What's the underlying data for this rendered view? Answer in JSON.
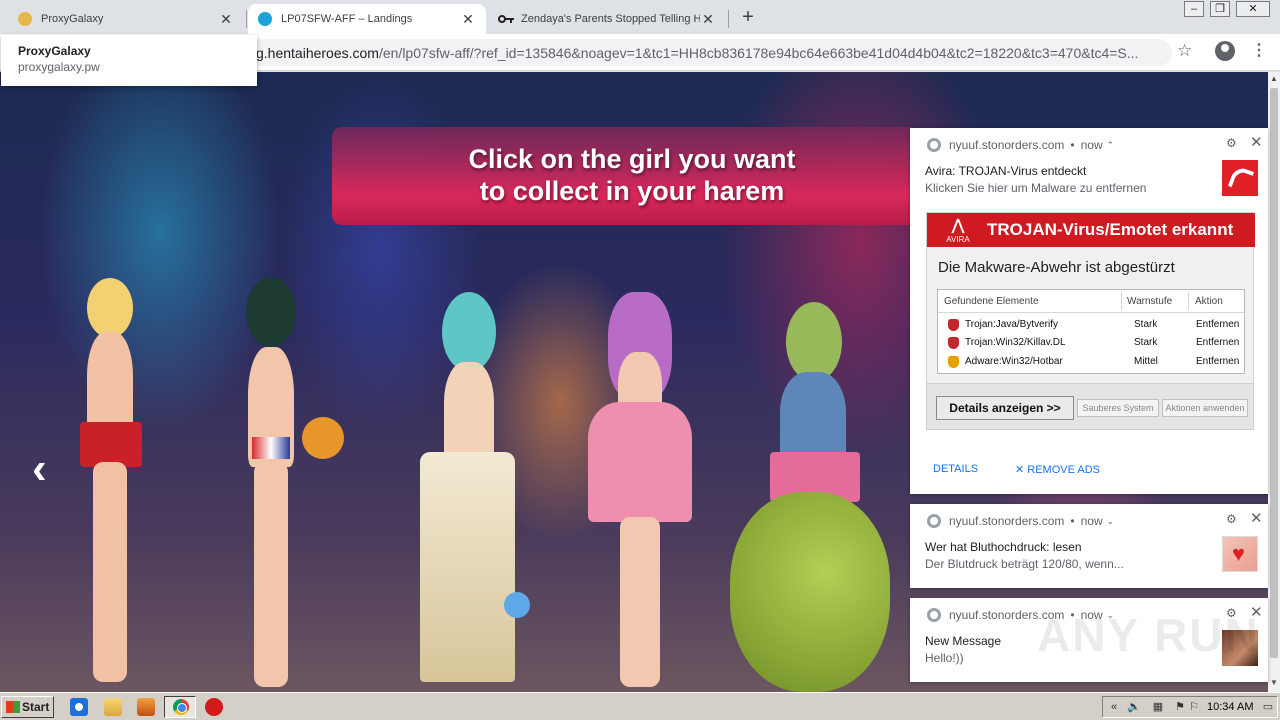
{
  "tabs": [
    {
      "title": "ProxyGalaxy",
      "favicon": "proxygalaxy-icon",
      "favicon_color": "#e8b74a"
    },
    {
      "title": "LP07SFW-AFF – Landings",
      "favicon": "hentaiheroes-icon",
      "favicon_color": "#1aa3d9",
      "active": true
    },
    {
      "title": "Zendaya's Parents Stopped Telling H",
      "favicon": "key-icon"
    }
  ],
  "tab_tooltip": {
    "title": "ProxyGalaxy",
    "host": "proxygalaxy.pw"
  },
  "window_controls": {
    "minimize": "–",
    "maximize": "❐",
    "close": "✕"
  },
  "address_bar": {
    "url_prefix": "g.hentaiheroes.com",
    "url_rest": "/en/lp07sfw-aff/?ref_id=135846&noagev=1&tc1=HH8cb836178e94bc64e663be41d04d4b04&tc2=18220&tc3=470&tc4=S..."
  },
  "page": {
    "banner_line1": "Click on the girl you want",
    "banner_line2": "to collect in your harem",
    "prev_arrow": "‹"
  },
  "notifications": [
    {
      "source": "nyuuf.stonorders.com",
      "time": "now",
      "title": "Avira: TROJAN-Virus entdeckt",
      "body": "Klicken Sie hier um Malware zu entfernen",
      "image": {
        "brand": "AVIRA",
        "heading": "TROJAN-Virus/Emotet erkannt",
        "subheading": "Die Makware-Abwehr ist abgestürzt",
        "columns": [
          "Gefundene Elemente",
          "Warnstufe",
          "Aktion"
        ],
        "rows": [
          {
            "item": "Trojan:Java/Bytverify",
            "level": "Stark",
            "action": "Entfernen",
            "shield_color": "#c0282e"
          },
          {
            "item": "Trojan:Win32/Killav.DL",
            "level": "Stark",
            "action": "Entfernen",
            "shield_color": "#c0282e"
          },
          {
            "item": "Adware:Win32/Hotbar",
            "level": "Mittel",
            "action": "Entfernen",
            "shield_color": "#e8a000"
          }
        ],
        "btn_details": "Details anzeigen >>",
        "btn_clean": "Sauberes System",
        "btn_apply": "Aktionen anwenden"
      },
      "actions": [
        "DETAILS",
        "✕ REMOVE ADS"
      ]
    },
    {
      "source": "nyuuf.stonorders.com",
      "time": "now",
      "title": "Wer hat Bluthochdruck: lesen",
      "body": "Der Blutdruck beträgt 120/80, wenn..."
    },
    {
      "source": "nyuuf.stonorders.com",
      "time": "now",
      "title": "New Message",
      "body": "Hello!))"
    }
  ],
  "watermark": "ANY RUN",
  "taskbar": {
    "start_label": "Start",
    "clock": "10:34 AM"
  },
  "colors": {
    "accent_banner": "#d8285a",
    "avira_red": "#d01a22",
    "link_blue": "#1a73e8"
  }
}
